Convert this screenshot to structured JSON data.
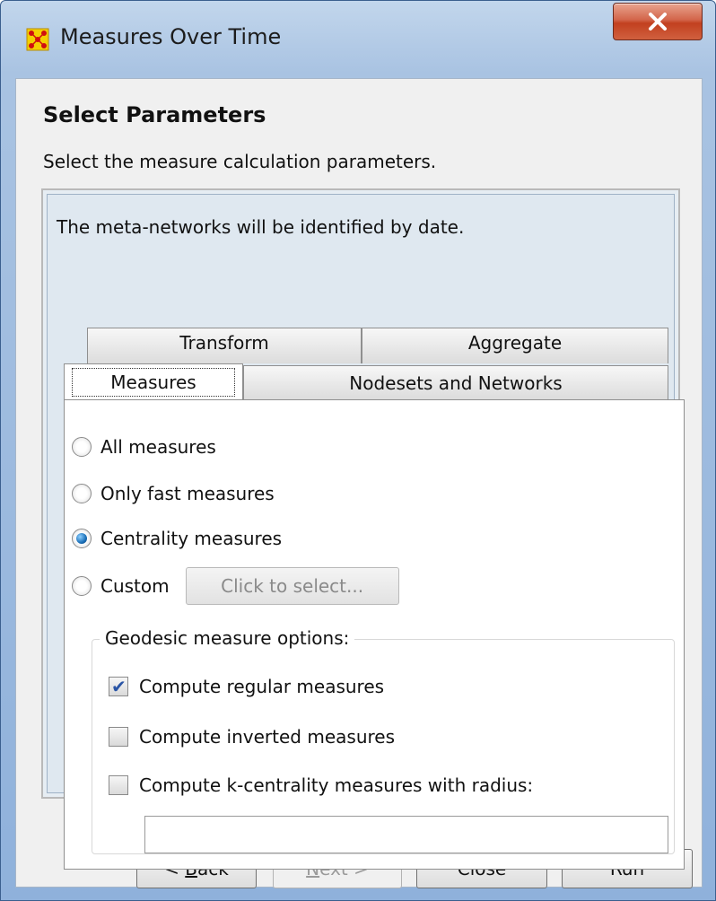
{
  "window": {
    "title": "Measures Over Time",
    "app_icon": "ora-grid-icon",
    "close_label": "X",
    "accent_color": "#c2401f"
  },
  "header": {
    "title": "Select Parameters",
    "subtitle": "Select the measure calculation parameters."
  },
  "panel": {
    "info_text": "The meta-networks will be identified by date.",
    "tabs_back_row": [
      {
        "label": "Transform"
      },
      {
        "label": "Aggregate"
      }
    ],
    "tabs_front_row": [
      {
        "label": "Measures",
        "active": true
      },
      {
        "label": "Nodesets and Networks",
        "active": false
      }
    ],
    "measure_options": [
      {
        "label": "All measures",
        "checked": false
      },
      {
        "label": "Only fast measures",
        "checked": false
      },
      {
        "label": "Centrality measures",
        "checked": true
      },
      {
        "label": "Custom",
        "checked": false
      }
    ],
    "custom_button_label": "Click to select...",
    "geodesic": {
      "legend": "Geodesic measure options:",
      "options": [
        {
          "label": "Compute regular measures",
          "checked": true
        },
        {
          "label": "Compute inverted measures",
          "checked": false
        },
        {
          "label": "Compute k-centrality measures with radius:",
          "checked": false
        }
      ],
      "radius_value": ""
    }
  },
  "footer": {
    "back": {
      "prefix": "< ",
      "mnemonic": "B",
      "rest": "ack"
    },
    "next": {
      "mnemonic": "N",
      "rest": "ext >"
    },
    "close": "Close",
    "run": "Run"
  }
}
